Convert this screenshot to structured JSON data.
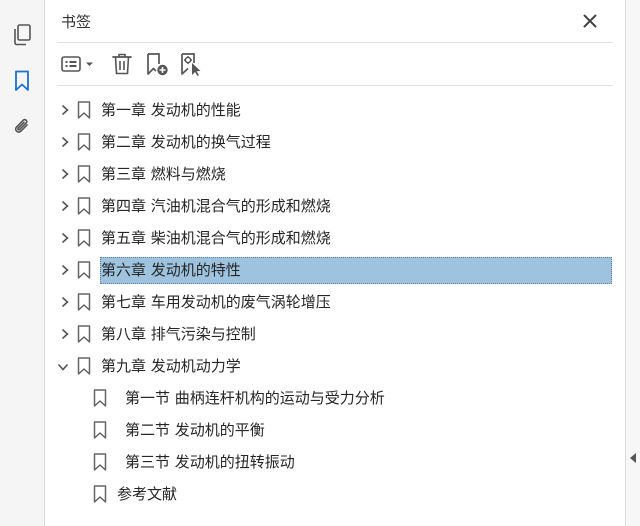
{
  "panel": {
    "title": "书签"
  },
  "left_rail": {
    "icons": [
      "pages-icon",
      "bookmark-icon",
      "attachment-icon"
    ]
  },
  "toolbar": {
    "icons": [
      "options-menu-icon",
      "delete-bookmark-icon",
      "new-bookmark-icon",
      "new-bookmark-from-structure-icon"
    ]
  },
  "bookmarks": [
    {
      "label": "第一章  发动机的性能",
      "expandable": true,
      "expanded": false,
      "selected": false,
      "level": 0
    },
    {
      "label": "第二章  发动机的换气过程",
      "expandable": true,
      "expanded": false,
      "selected": false,
      "level": 0
    },
    {
      "label": "第三章  燃料与燃烧",
      "expandable": true,
      "expanded": false,
      "selected": false,
      "level": 0
    },
    {
      "label": "第四章  汽油机混合气的形成和燃烧",
      "expandable": true,
      "expanded": false,
      "selected": false,
      "level": 0
    },
    {
      "label": "第五章  柴油机混合气的形成和燃烧",
      "expandable": true,
      "expanded": false,
      "selected": false,
      "level": 0
    },
    {
      "label": "第六章  发动机的特性",
      "expandable": true,
      "expanded": false,
      "selected": true,
      "level": 0
    },
    {
      "label": "第七章  车用发动机的废气涡轮增压",
      "expandable": true,
      "expanded": false,
      "selected": false,
      "level": 0
    },
    {
      "label": "第八章  排气污染与控制",
      "expandable": true,
      "expanded": false,
      "selected": false,
      "level": 0
    },
    {
      "label": "第九章  发动机动力学",
      "expandable": true,
      "expanded": true,
      "selected": false,
      "level": 0
    },
    {
      "label": "第一节  曲柄连杆机构的运动与受力分析",
      "expandable": false,
      "expanded": false,
      "selected": false,
      "level": 1
    },
    {
      "label": "第二节  发动机的平衡",
      "expandable": false,
      "expanded": false,
      "selected": false,
      "level": 1
    },
    {
      "label": "第三节  发动机的扭转振动",
      "expandable": false,
      "expanded": false,
      "selected": false,
      "level": 1
    },
    {
      "label": "参考文献",
      "expandable": false,
      "expanded": false,
      "selected": false,
      "level": 0
    }
  ],
  "colors": {
    "selection": "#9ec3df",
    "accent": "#1a73c8",
    "icon": "#555555"
  }
}
